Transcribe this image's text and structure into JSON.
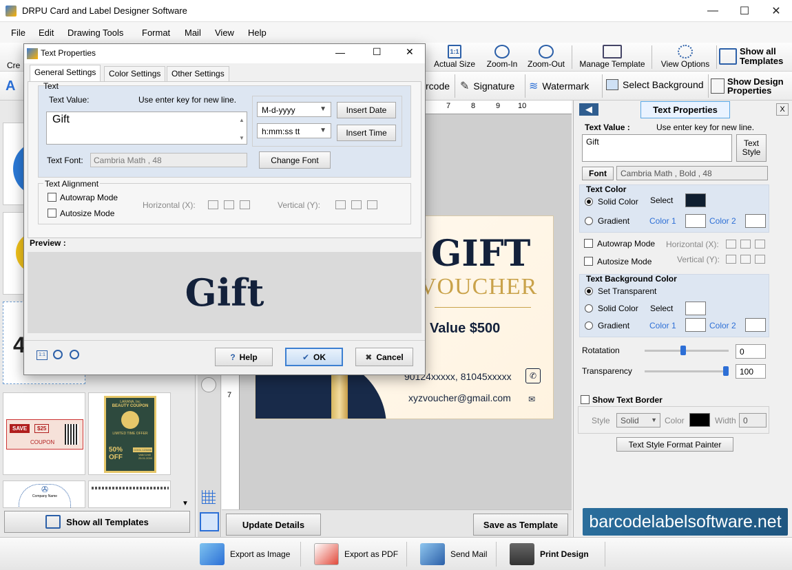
{
  "window": {
    "title": "DRPU Card and Label Designer Software",
    "min": "—",
    "max": "☐",
    "close": "✕"
  },
  "menu": [
    "File",
    "Edit",
    "Drawing Tools",
    "Format",
    "Mail",
    "View",
    "Help"
  ],
  "toolbar1": {
    "create_partial": "Cre",
    "actual_size": "Actual Size",
    "zoom_in": "Zoom-In",
    "zoom_out": "Zoom-Out",
    "manage_template": "Manage Template",
    "view_options": "View Options",
    "show_all_templates": "Show all\nTemplates"
  },
  "toolbar2": {
    "barcode_partial": "rcode",
    "signature": "Signature",
    "watermark": "Watermark",
    "select_background": "Select Background",
    "show_design_properties": "Show Design\nProperties"
  },
  "ruler": {
    "top": [
      "7",
      "8",
      "9",
      "10"
    ],
    "left": [
      "7"
    ]
  },
  "card": {
    "line1": "GIFT",
    "line2": "VOUCHER",
    "value": "Value $500",
    "phone": "90124xxxxx, 81045xxxxx",
    "email": "xyzvoucher@gmail.com"
  },
  "left_panel": {
    "coupon_save": "SAVE",
    "coupon_amount": "$25",
    "coupon_label": "COUPON",
    "beauty_brand": "LARANA, Inc",
    "beauty_title": "BEAUTY COUPON",
    "beauty_offer": "LIMITED TIME OFFER",
    "beauty_percent": "50%\nOFF",
    "beauty_code": "COOL 123456",
    "beauty_valid": "Valid Until\n25.01.2030",
    "company_name": "Company Name",
    "show_all_templates": "Show all Templates"
  },
  "canvas_bottom": {
    "update_details": "Update Details",
    "save_as_template": "Save as Template"
  },
  "properties": {
    "header": "Text Properties",
    "text_value_label": "Text Value :",
    "text_value_hint": "Use enter key for new line.",
    "text_value": "Gift",
    "text_style_btn": "Text\nStyle",
    "font_btn": "Font",
    "font_value": "Cambria Math , Bold , 48",
    "text_color": {
      "title": "Text Color",
      "solid_color": "Solid Color",
      "select": "Select",
      "gradient": "Gradient",
      "color1": "Color 1",
      "color2": "Color 2",
      "selected_color": "#0f1e30"
    },
    "autowrap": "Autowrap Mode",
    "autosize": "Autosize Mode",
    "horizontal": "Horizontal (X):",
    "vertical": "Vertical (Y):",
    "bg_color": {
      "title": "Text Background Color",
      "set_transparent": "Set Transparent",
      "solid_color": "Solid Color",
      "select": "Select",
      "gradient": "Gradient",
      "color1": "Color 1",
      "color2": "Color 2"
    },
    "rotation_label": "Rotatation",
    "rotation_value": "0",
    "rotation_fraction": 0.46,
    "transparency_label": "Transparency",
    "transparency_value": "100",
    "transparency_fraction": 1.0,
    "show_text_border": "Show Text Border",
    "style_label": "Style",
    "style_value": "Solid",
    "color_label": "Color",
    "width_label": "Width",
    "width_value": "0",
    "format_painter": "Text Style Format Painter"
  },
  "brand": "barcodelabelsoftware.net",
  "actions": {
    "export_image": "Export as Image",
    "export_pdf": "Export as PDF",
    "send_mail": "Send Mail",
    "print_design": "Print Design"
  },
  "dialog": {
    "title": "Text Properties",
    "tabs": [
      "General Settings",
      "Color Settings",
      "Other Settings"
    ],
    "text_group": "Text",
    "text_value_label": "Text Value:",
    "text_value_hint": "Use enter key for new line.",
    "text_value": "Gift",
    "date_format": "M-d-yyyy",
    "time_format": "h:mm:ss tt",
    "insert_date": "Insert Date",
    "insert_time": "Insert Time",
    "text_font_label": "Text Font:",
    "text_font_value": "Cambria Math , 48",
    "change_font": "Change Font",
    "alignment_group": "Text Alignment",
    "autowrap": "Autowrap Mode",
    "autosize": "Autosize Mode",
    "horizontal": "Horizontal (X):",
    "vertical": "Vertical (Y):",
    "preview_label": "Preview :",
    "preview_text": "Gift",
    "help": "Help",
    "ok": "OK",
    "cancel": "Cancel"
  }
}
